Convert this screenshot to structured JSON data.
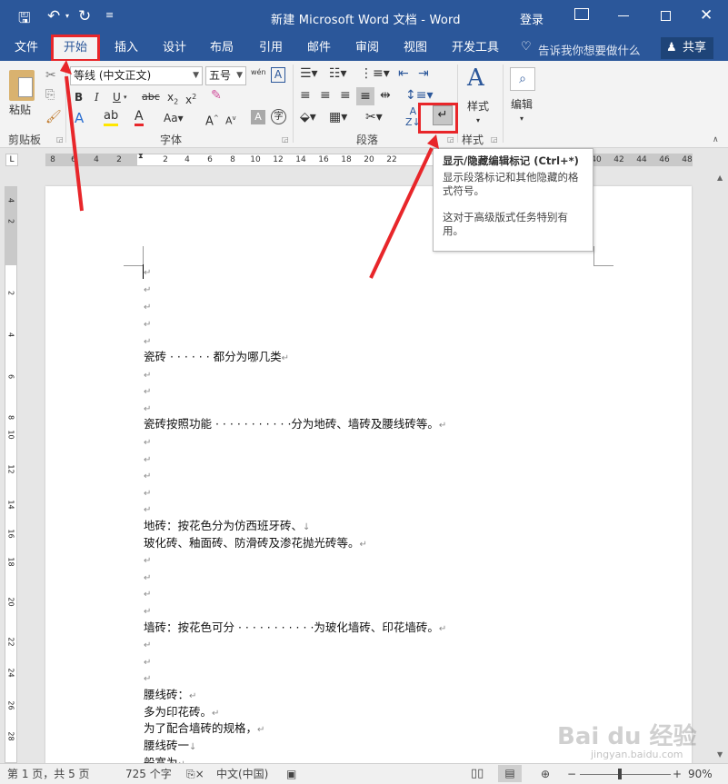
{
  "titlebar": {
    "title": "新建 Microsoft Word 文档 - Word",
    "signin": "登录"
  },
  "tabs": [
    {
      "label": "文件"
    },
    {
      "label": "开始"
    },
    {
      "label": "插入"
    },
    {
      "label": "设计"
    },
    {
      "label": "布局"
    },
    {
      "label": "引用"
    },
    {
      "label": "邮件"
    },
    {
      "label": "审阅"
    },
    {
      "label": "视图"
    },
    {
      "label": "开发工具"
    }
  ],
  "tellme": "告诉我你想要做什么",
  "share": "共享",
  "ribbon": {
    "paste_label": "粘贴",
    "font_name": "等线 (中文正文)",
    "font_size": "五号",
    "wen_glyph": "wén",
    "groups": {
      "clipboard": "剪贴板",
      "font": "字体",
      "paragraph": "段落",
      "styles": "样式"
    },
    "styles_label": "样式",
    "edit_label": "编辑"
  },
  "tooltip": {
    "title": "显示/隐藏编辑标记 (Ctrl+*)",
    "desc": "显示段落标记和其他隐藏的格式符号。",
    "note": "这对于高级版式任务特别有用。"
  },
  "hruler": [
    "8",
    "6",
    "4",
    "2",
    "2",
    "4",
    "6",
    "8",
    "10",
    "12",
    "14",
    "16",
    "18",
    "20",
    "22",
    "40",
    "42",
    "44",
    "46",
    "48"
  ],
  "vruler": [
    "4",
    "2",
    "2",
    "4",
    "6",
    "8",
    "10",
    "12",
    "14",
    "16",
    "18",
    "20",
    "22",
    "24",
    "26",
    "28"
  ],
  "document": {
    "pm": "↵",
    "lb": "↓",
    "lines": [
      {
        "text": "瓷砖 · · · · · · 都分为哪几类",
        "mark": "↵"
      },
      {
        "text": "瓷砖按照功能 · · · · · · · · · · ·分为地砖、墙砖及腰线砖等。",
        "mark": "↵"
      },
      {
        "text": "地砖：按花色分为仿西班牙砖、",
        "mark": "↓"
      },
      {
        "text": "玻化砖、釉面砖、防滑砖及渗花抛光砖等。",
        "mark": "↵"
      },
      {
        "text": "墙砖：按花色可分 · · · · · · · · · · ·为玻化墙砖、印花墙砖。",
        "mark": "↵"
      },
      {
        "text": "腰线砖：",
        "mark": "↵"
      },
      {
        "text": "多为印花砖。",
        "mark": "↵"
      },
      {
        "text": "为了配合墙砖的规格，",
        "mark": "↵"
      },
      {
        "text": "腰线砖一",
        "mark": "↓"
      },
      {
        "text": "般宽为",
        "mark": "↵"
      }
    ]
  },
  "status": {
    "page": "第 1 页，共 5 页",
    "words": "725 个字",
    "lang": "中文(中国)",
    "zoom": "90%"
  },
  "watermark": {
    "brand": "Bai du 经验",
    "url": "jingyan.baidu.com"
  },
  "colors": {
    "accent": "#2b579a",
    "highlight": "#e8262a"
  }
}
